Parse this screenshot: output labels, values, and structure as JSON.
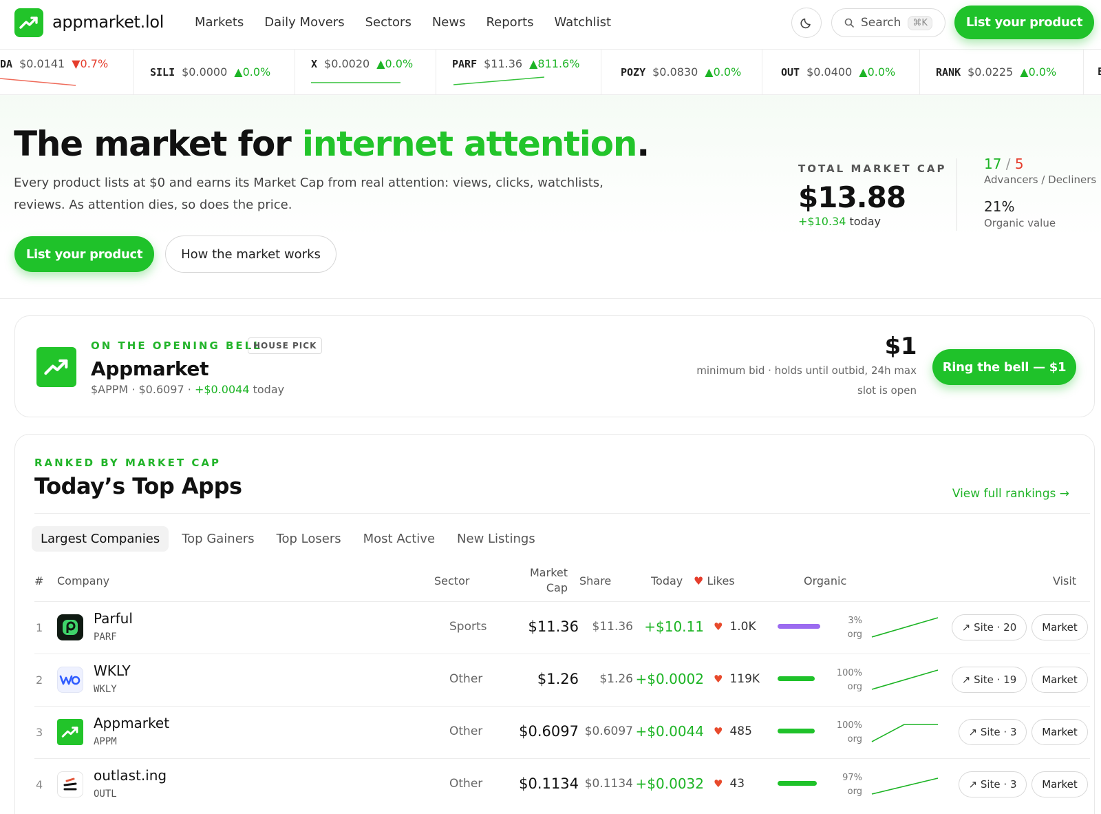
{
  "nav": {
    "brand": "appmarket.lol",
    "links": [
      "Markets",
      "Daily Movers",
      "Sectors",
      "News",
      "Reports",
      "Watchlist"
    ],
    "search_placeholder": "Search",
    "search_shortcut": "⌘K",
    "cta": "List your product"
  },
  "ticker": [
    {
      "sym": "DA",
      "price": "$0.0141",
      "change": "▼0.7%",
      "dir": "down"
    },
    {
      "sym": "SILI",
      "price": "$0.0000",
      "change": "▲0.0%",
      "dir": "up"
    },
    {
      "sym": "X",
      "price": "$0.0020",
      "change": "▲0.0%",
      "dir": "up"
    },
    {
      "sym": "PARF",
      "price": "$11.36",
      "change": "▲811.6%",
      "dir": "up"
    },
    {
      "sym": "POZY",
      "price": "$0.0830",
      "change": "▲0.0%",
      "dir": "up"
    },
    {
      "sym": "OUT",
      "price": "$0.0400",
      "change": "▲0.0%",
      "dir": "up"
    },
    {
      "sym": "RANK",
      "price": "$0.0225",
      "change": "▲0.0%",
      "dir": "up"
    },
    {
      "sym": "E",
      "price": "",
      "change": "",
      "dir": "up"
    }
  ],
  "hero": {
    "title_prefix": "The market for ",
    "title_highlight": "internet attention",
    "title_suffix": ".",
    "subtitle": "Every product lists at $0 and earns its Market Cap from real attention: views, clicks, watchlists, reviews. As attention dies, so does the price.",
    "cta_primary": "List your product",
    "cta_secondary": "How the market works",
    "market_cap_label": "TOTAL MARKET CAP",
    "market_cap_value": "$13.88",
    "market_cap_delta": "+$10.34",
    "market_cap_delta_suffix": " today",
    "advancers": "17",
    "decliners": "5",
    "adv_dec_label": "Advancers / Decliners",
    "organic_value": "21%",
    "organic_label": "Organic value"
  },
  "opening_bell": {
    "kicker": "ON THE OPENING BELL",
    "badge": "HOUSE PICK",
    "name": "Appmarket",
    "ticker": "$APPM",
    "price": "$0.6097",
    "delta": "+$0.0044",
    "delta_suffix": " today",
    "bid": "$1",
    "bid_note": "minimum bid · holds until outbid, 24h max",
    "slot_status": "slot is open",
    "cta": "Ring the bell — $1"
  },
  "rankings": {
    "kicker": "RANKED BY MARKET CAP",
    "title": "Today’s Top Apps",
    "link": "View full rankings →",
    "tabs": [
      "Largest Companies",
      "Top Gainers",
      "Top Losers",
      "Most Active",
      "New Listings"
    ],
    "headers": {
      "rank": "#",
      "company": "Company",
      "sector": "Sector",
      "market_cap_1": "Market",
      "market_cap_2": "Cap",
      "share": "Share",
      "today": "Today",
      "likes": "Likes",
      "organic": "Organic",
      "visit": "Visit"
    },
    "rows": [
      {
        "rank": "1",
        "name": "Parful",
        "ticker": "PARF",
        "sector": "Sports",
        "market_cap": "$11.36",
        "share": "$11.36",
        "today": "+$10.11",
        "likes": "1.0K",
        "organic": "3%",
        "organic_fraction": 0.03,
        "organic_unit": "org",
        "site": "↗ Site · 20",
        "market": "Market"
      },
      {
        "rank": "2",
        "name": "WKLY",
        "ticker": "WKLY",
        "sector": "Other",
        "market_cap": "$1.26",
        "share": "$1.26",
        "today": "+$0.0002",
        "likes": "119K",
        "organic": "100%",
        "organic_fraction": 1.0,
        "organic_unit": "org",
        "site": "↗ Site · 19",
        "market": "Market"
      },
      {
        "rank": "3",
        "name": "Appmarket",
        "ticker": "APPM",
        "sector": "Other",
        "market_cap": "$0.6097",
        "share": "$0.6097",
        "today": "+$0.0044",
        "likes": "485",
        "organic": "100%",
        "organic_fraction": 1.0,
        "organic_unit": "org",
        "site": "↗ Site · 3",
        "market": "Market"
      },
      {
        "rank": "4",
        "name": "outlast.ing",
        "ticker": "OUTL",
        "sector": "Other",
        "market_cap": "$0.1134",
        "share": "$0.1134",
        "today": "+$0.0032",
        "likes": "43",
        "organic": "97%",
        "organic_fraction": 0.97,
        "organic_unit": "org",
        "site": "↗ Site · 3",
        "market": "Market"
      }
    ]
  },
  "colors": {
    "accent": "#22c42a",
    "up": "#1db425",
    "down": "#e53d2c",
    "organic_low": "#9b6bf0",
    "organic_high": "#1fc22a"
  },
  "icons": [
    "trend-up-logo-icon",
    "moon-icon",
    "search-icon",
    "heart-icon",
    "external-link-icon"
  ]
}
